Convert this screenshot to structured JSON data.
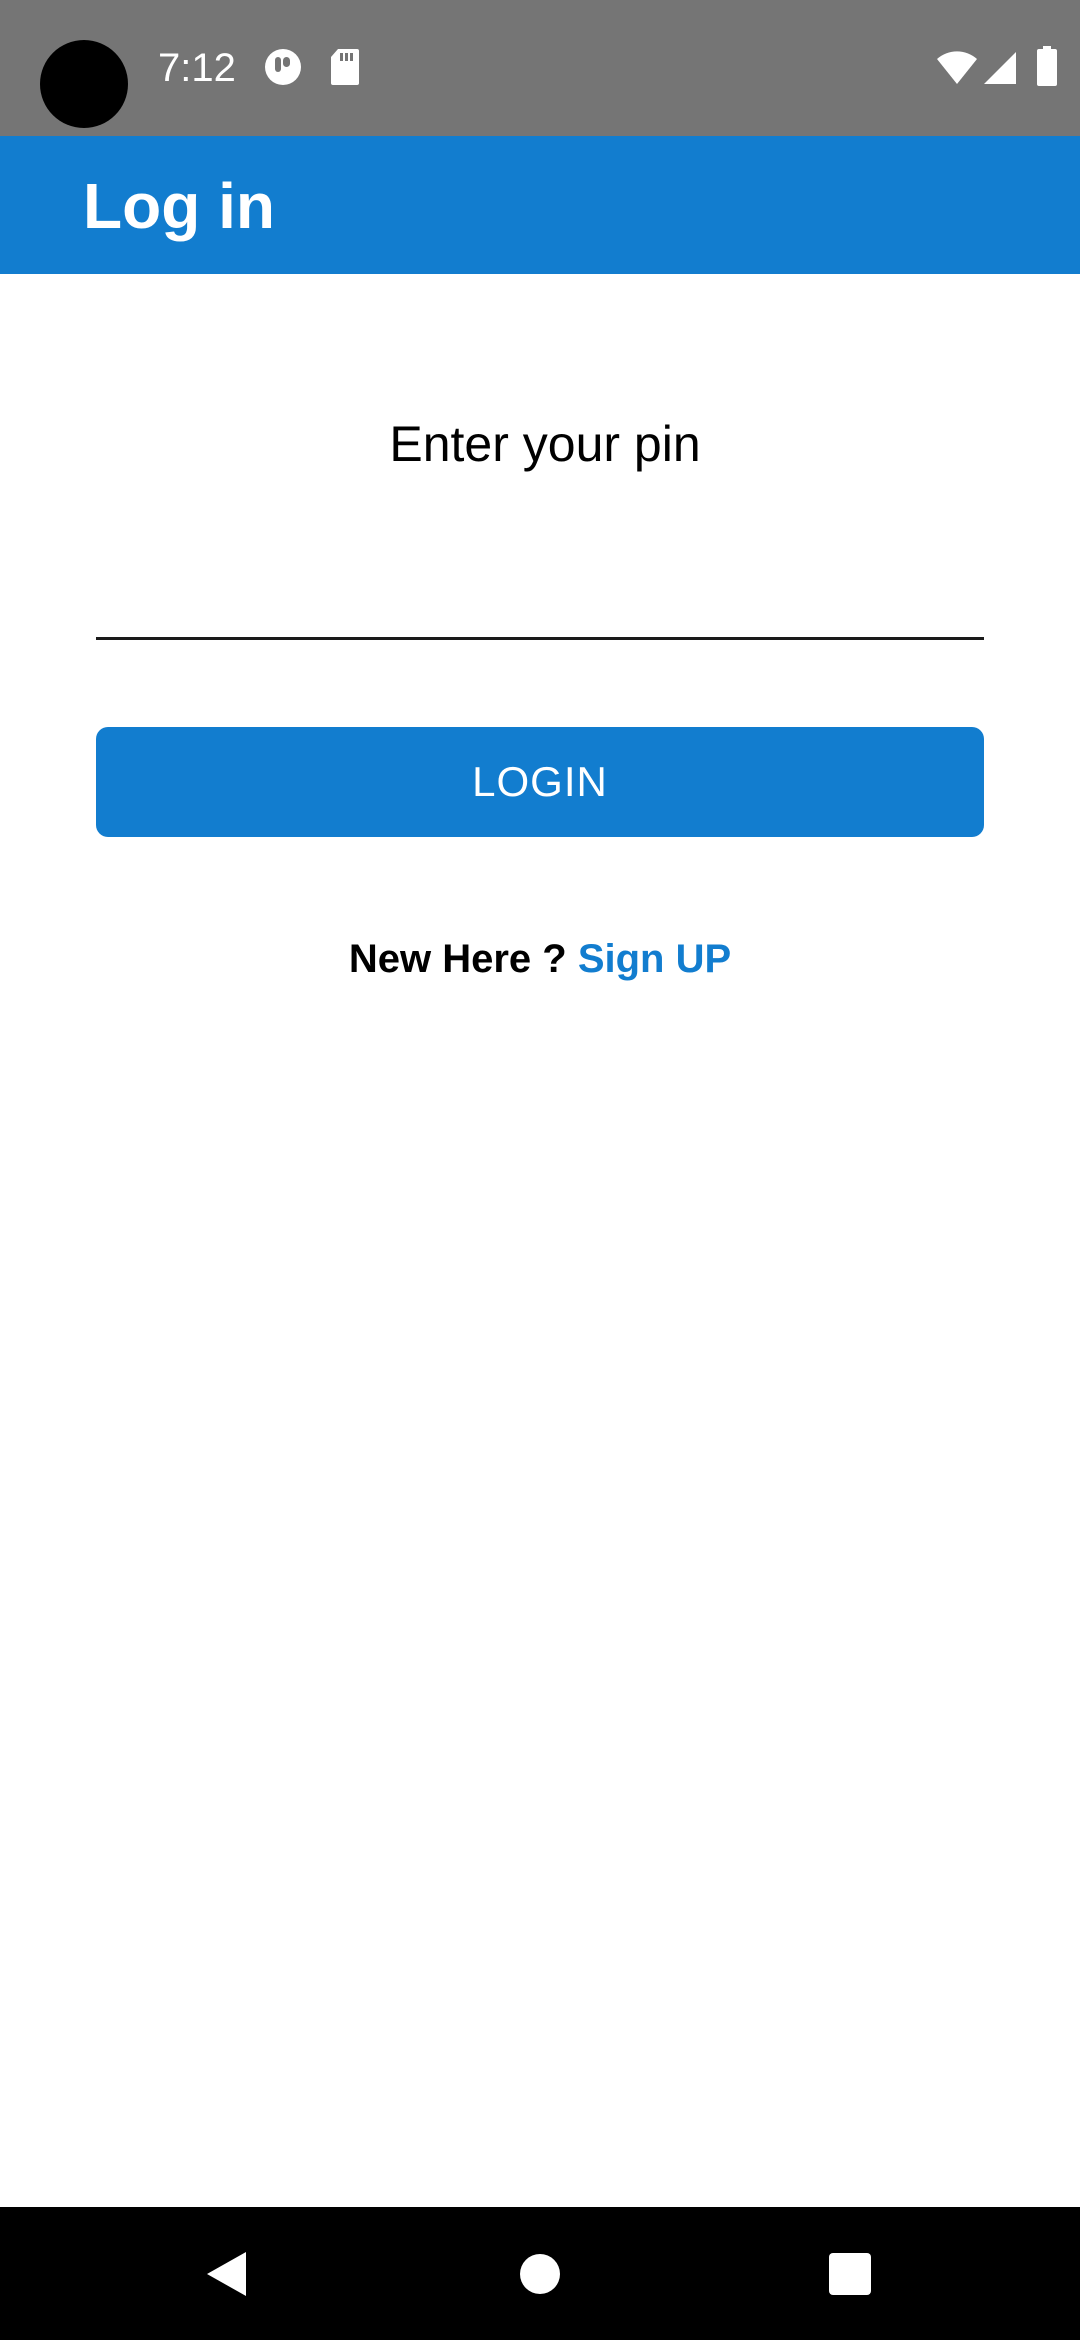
{
  "status_bar": {
    "time": "7:12",
    "icons": [
      "cutout-icon",
      "app-notification-icon",
      "sd-card-icon",
      "wifi-icon",
      "signal-icon",
      "battery-icon"
    ]
  },
  "app_bar": {
    "title": "Log in"
  },
  "login_form": {
    "pin_label": "Enter your pin",
    "pin_value": "",
    "login_button_label": "LOGIN",
    "signup_prompt": "New Here ?",
    "signup_link": "Sign UP"
  },
  "nav_bar": {
    "buttons": [
      "back-icon",
      "home-icon",
      "recents-icon"
    ]
  },
  "colors": {
    "accent": "#127dcf",
    "status_bar": "#757575",
    "nav_bar": "#000000"
  }
}
